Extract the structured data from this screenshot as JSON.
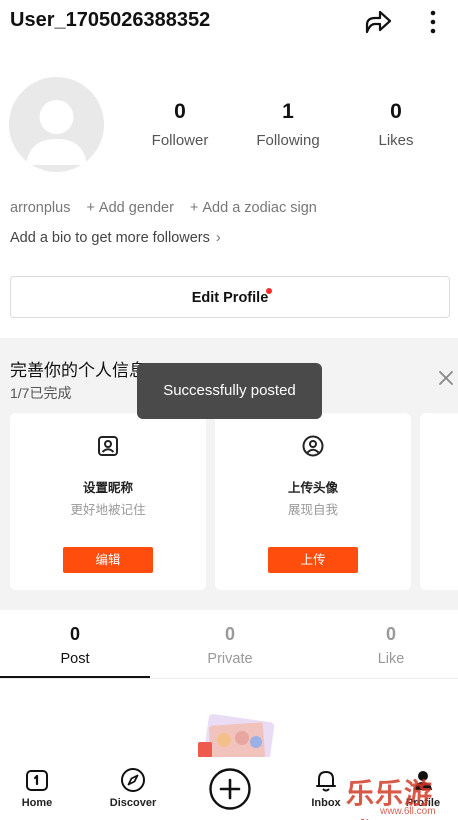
{
  "header": {
    "username": "User_1705026388352"
  },
  "stats": [
    {
      "value": "0",
      "label": "Follower"
    },
    {
      "value": "1",
      "label": "Following"
    },
    {
      "value": "0",
      "label": "Likes"
    }
  ],
  "meta": {
    "handle": "arronplus",
    "add_gender": "Add gender",
    "add_zodiac": "Add a zodiac sign",
    "plus": "+"
  },
  "bio": {
    "text": "Add a bio to get more followers",
    "chevron": "›"
  },
  "edit_profile": {
    "label": "Edit Profile"
  },
  "completion": {
    "title": "完善你的个人信息",
    "progress": "1/7已完成",
    "cards": [
      {
        "title": "设置昵称",
        "desc": "更好地被记住",
        "button": "编辑",
        "icon": "id-card-icon"
      },
      {
        "title": "上传头像",
        "desc": "展现自我",
        "button": "上传",
        "icon": "avatar-circle-icon"
      }
    ]
  },
  "toast": {
    "message": "Successfully posted"
  },
  "tabs": [
    {
      "count": "0",
      "label": "Post",
      "active": true
    },
    {
      "count": "0",
      "label": "Private",
      "active": false
    },
    {
      "count": "0",
      "label": "Like",
      "active": false
    }
  ],
  "nav": {
    "home": "Home",
    "discover": "Discover",
    "inbox": "Inbox",
    "profile": "Profile"
  },
  "watermark": {
    "text": "乐乐游戏",
    "url": "www.6ll.com"
  },
  "colors": {
    "accent": "#ff4d0d",
    "notify_dot": "#ff2a2a",
    "toast_bg": "#4a4a4a",
    "band_bg": "#f3f3f3"
  }
}
